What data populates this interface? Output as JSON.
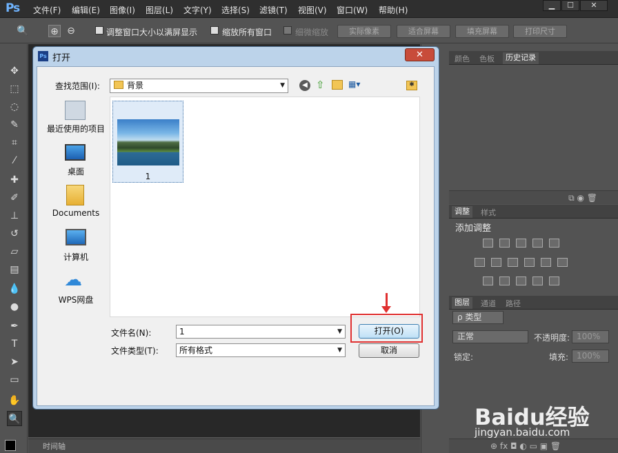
{
  "app": {
    "logo": "Ps",
    "menu": [
      "文件(F)",
      "编辑(E)",
      "图像(I)",
      "图层(L)",
      "文字(Y)",
      "选择(S)",
      "滤镜(T)",
      "视图(V)",
      "窗口(W)",
      "帮助(H)"
    ],
    "window_controls": {
      "minimize": "▁",
      "maximize": "☐",
      "close": "✕"
    }
  },
  "options_bar": {
    "checkbox_resize": "调整窗口大小以满屏显示",
    "checkbox_zoom_all": "缩放所有窗口",
    "checkbox_scrubby": "细微缩放",
    "btn_actual": "实际像素",
    "btn_fit": "适合屏幕",
    "btn_fill": "填充屏幕",
    "btn_print": "打印尺寸"
  },
  "timeline": {
    "label": "时间轴"
  },
  "panels": {
    "top_tabs": [
      "颜色",
      "色板",
      "历史记录"
    ],
    "adjust_tabs": [
      "调整",
      "样式"
    ],
    "adjust_title": "添加调整",
    "layers_tabs": [
      "图层",
      "通道",
      "路径"
    ],
    "layers_filter": "ρ 类型",
    "blend_mode": "正常",
    "opacity_label": "不透明度:",
    "opacity_value": "100%",
    "lock_label": "锁定:",
    "fill_label": "填充:",
    "fill_value": "100%",
    "footer_icons": "⊕ fx ◘ ◐ ▭ ▣ 🗑"
  },
  "dialog": {
    "title": "打开",
    "look_in_label": "查找范围(I):",
    "look_in_value": "背景",
    "places": [
      {
        "label": "最近使用的项目",
        "icon": "recent-icon"
      },
      {
        "label": "桌面",
        "icon": "desktop-icon"
      },
      {
        "label": "Documents",
        "icon": "folder-icon"
      },
      {
        "label": "计算机",
        "icon": "computer-icon"
      },
      {
        "label": "WPS网盘",
        "icon": "cloud-icon"
      }
    ],
    "files": [
      {
        "name": "1"
      }
    ],
    "filename_label": "文件名(N):",
    "filename_value": "1",
    "filetype_label": "文件类型(T):",
    "filetype_value": "所有格式",
    "open_button": "打开(O)",
    "cancel_button": "取消"
  },
  "watermark": {
    "logo": "Baidu经验",
    "url": "jingyan.baidu.com"
  }
}
